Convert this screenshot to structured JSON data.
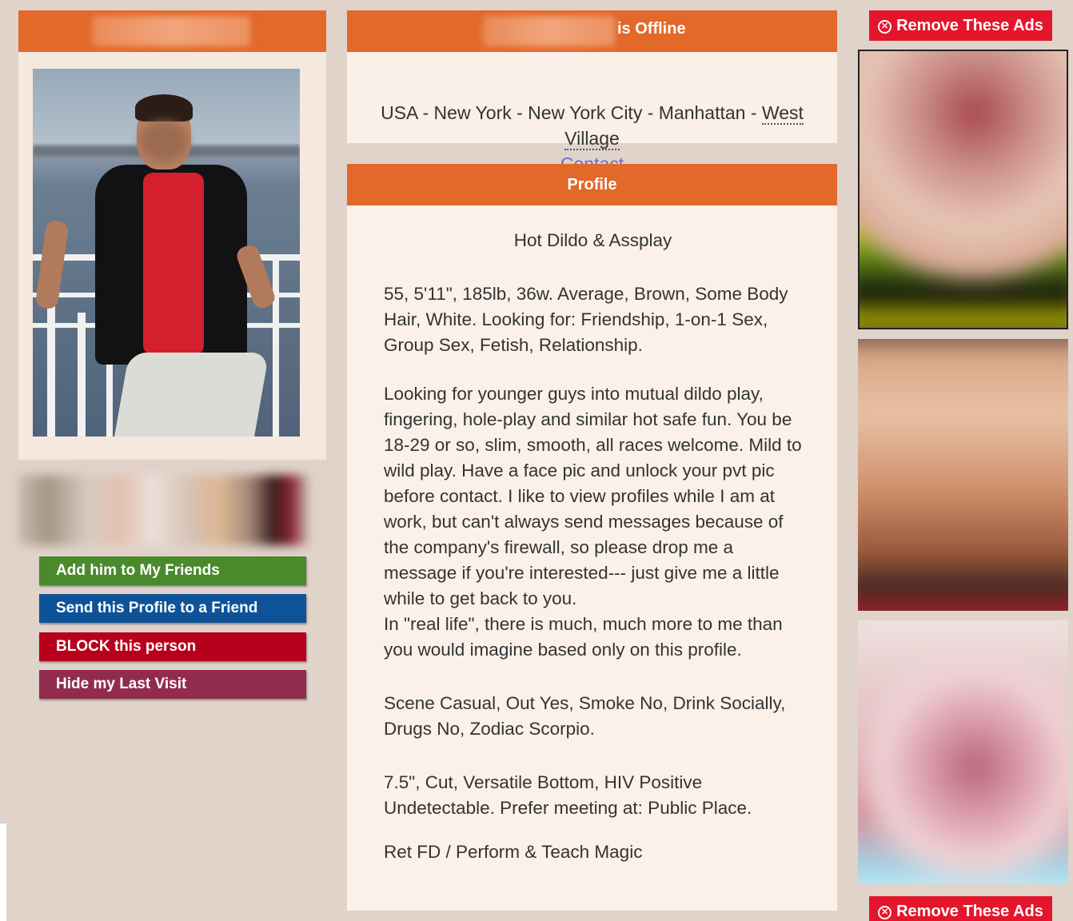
{
  "header": {
    "status_text": "is Offline"
  },
  "location": {
    "prefix": "USA - New York - New York City - Manhattan - ",
    "neighborhood": "West Village",
    "contact_label": "Contact"
  },
  "actions": {
    "add_friend": "Add him to My Friends",
    "send_profile": "Send this Profile to a Friend",
    "block": "BLOCK this person",
    "hide_visit": "Hide my Last Visit"
  },
  "profile": {
    "header": "Profile",
    "tagline": "Hot Dildo & Assplay",
    "stats": "55, 5'11\", 185lb, 36w. Average, Brown, Some Body Hair, White. Looking for: Friendship, 1-on-1 Sex, Group Sex, Fetish, Relationship.",
    "about": "Looking for younger guys into mutual dildo play, fingering, hole-play and similar hot safe fun. You be 18-29 or so, slim, smooth, all races welcome. Mild to wild play. Have a face pic and unlock your pvt pic before contact. I like to view profiles while I am at work, but can't always send messages because of the company's firewall, so please drop me a message if you're interested--- just give me a little while to get back to you.\nIn \"real life\", there is much, much more to me than you would imagine based only on this profile.",
    "lifestyle": "Scene Casual, Out Yes, Smoke No, Drink Socially, Drugs No, Zodiac Scorpio.",
    "details": "7.5\", Cut, Versatile Bottom, HIV Positive Undetectable. Prefer meeting at: Public Place.",
    "extra": "Ret FD / Perform & Teach Magic"
  },
  "ads": {
    "remove_label": "Remove These Ads"
  },
  "colors": {
    "header_orange": "#e2692a",
    "friend_green": "#4a8a2c",
    "send_blue": "#0e5398",
    "block_red": "#b8001c",
    "hide_purple": "#922c4f",
    "ads_red": "#e5152c",
    "link_color": "#6b6bcc"
  }
}
